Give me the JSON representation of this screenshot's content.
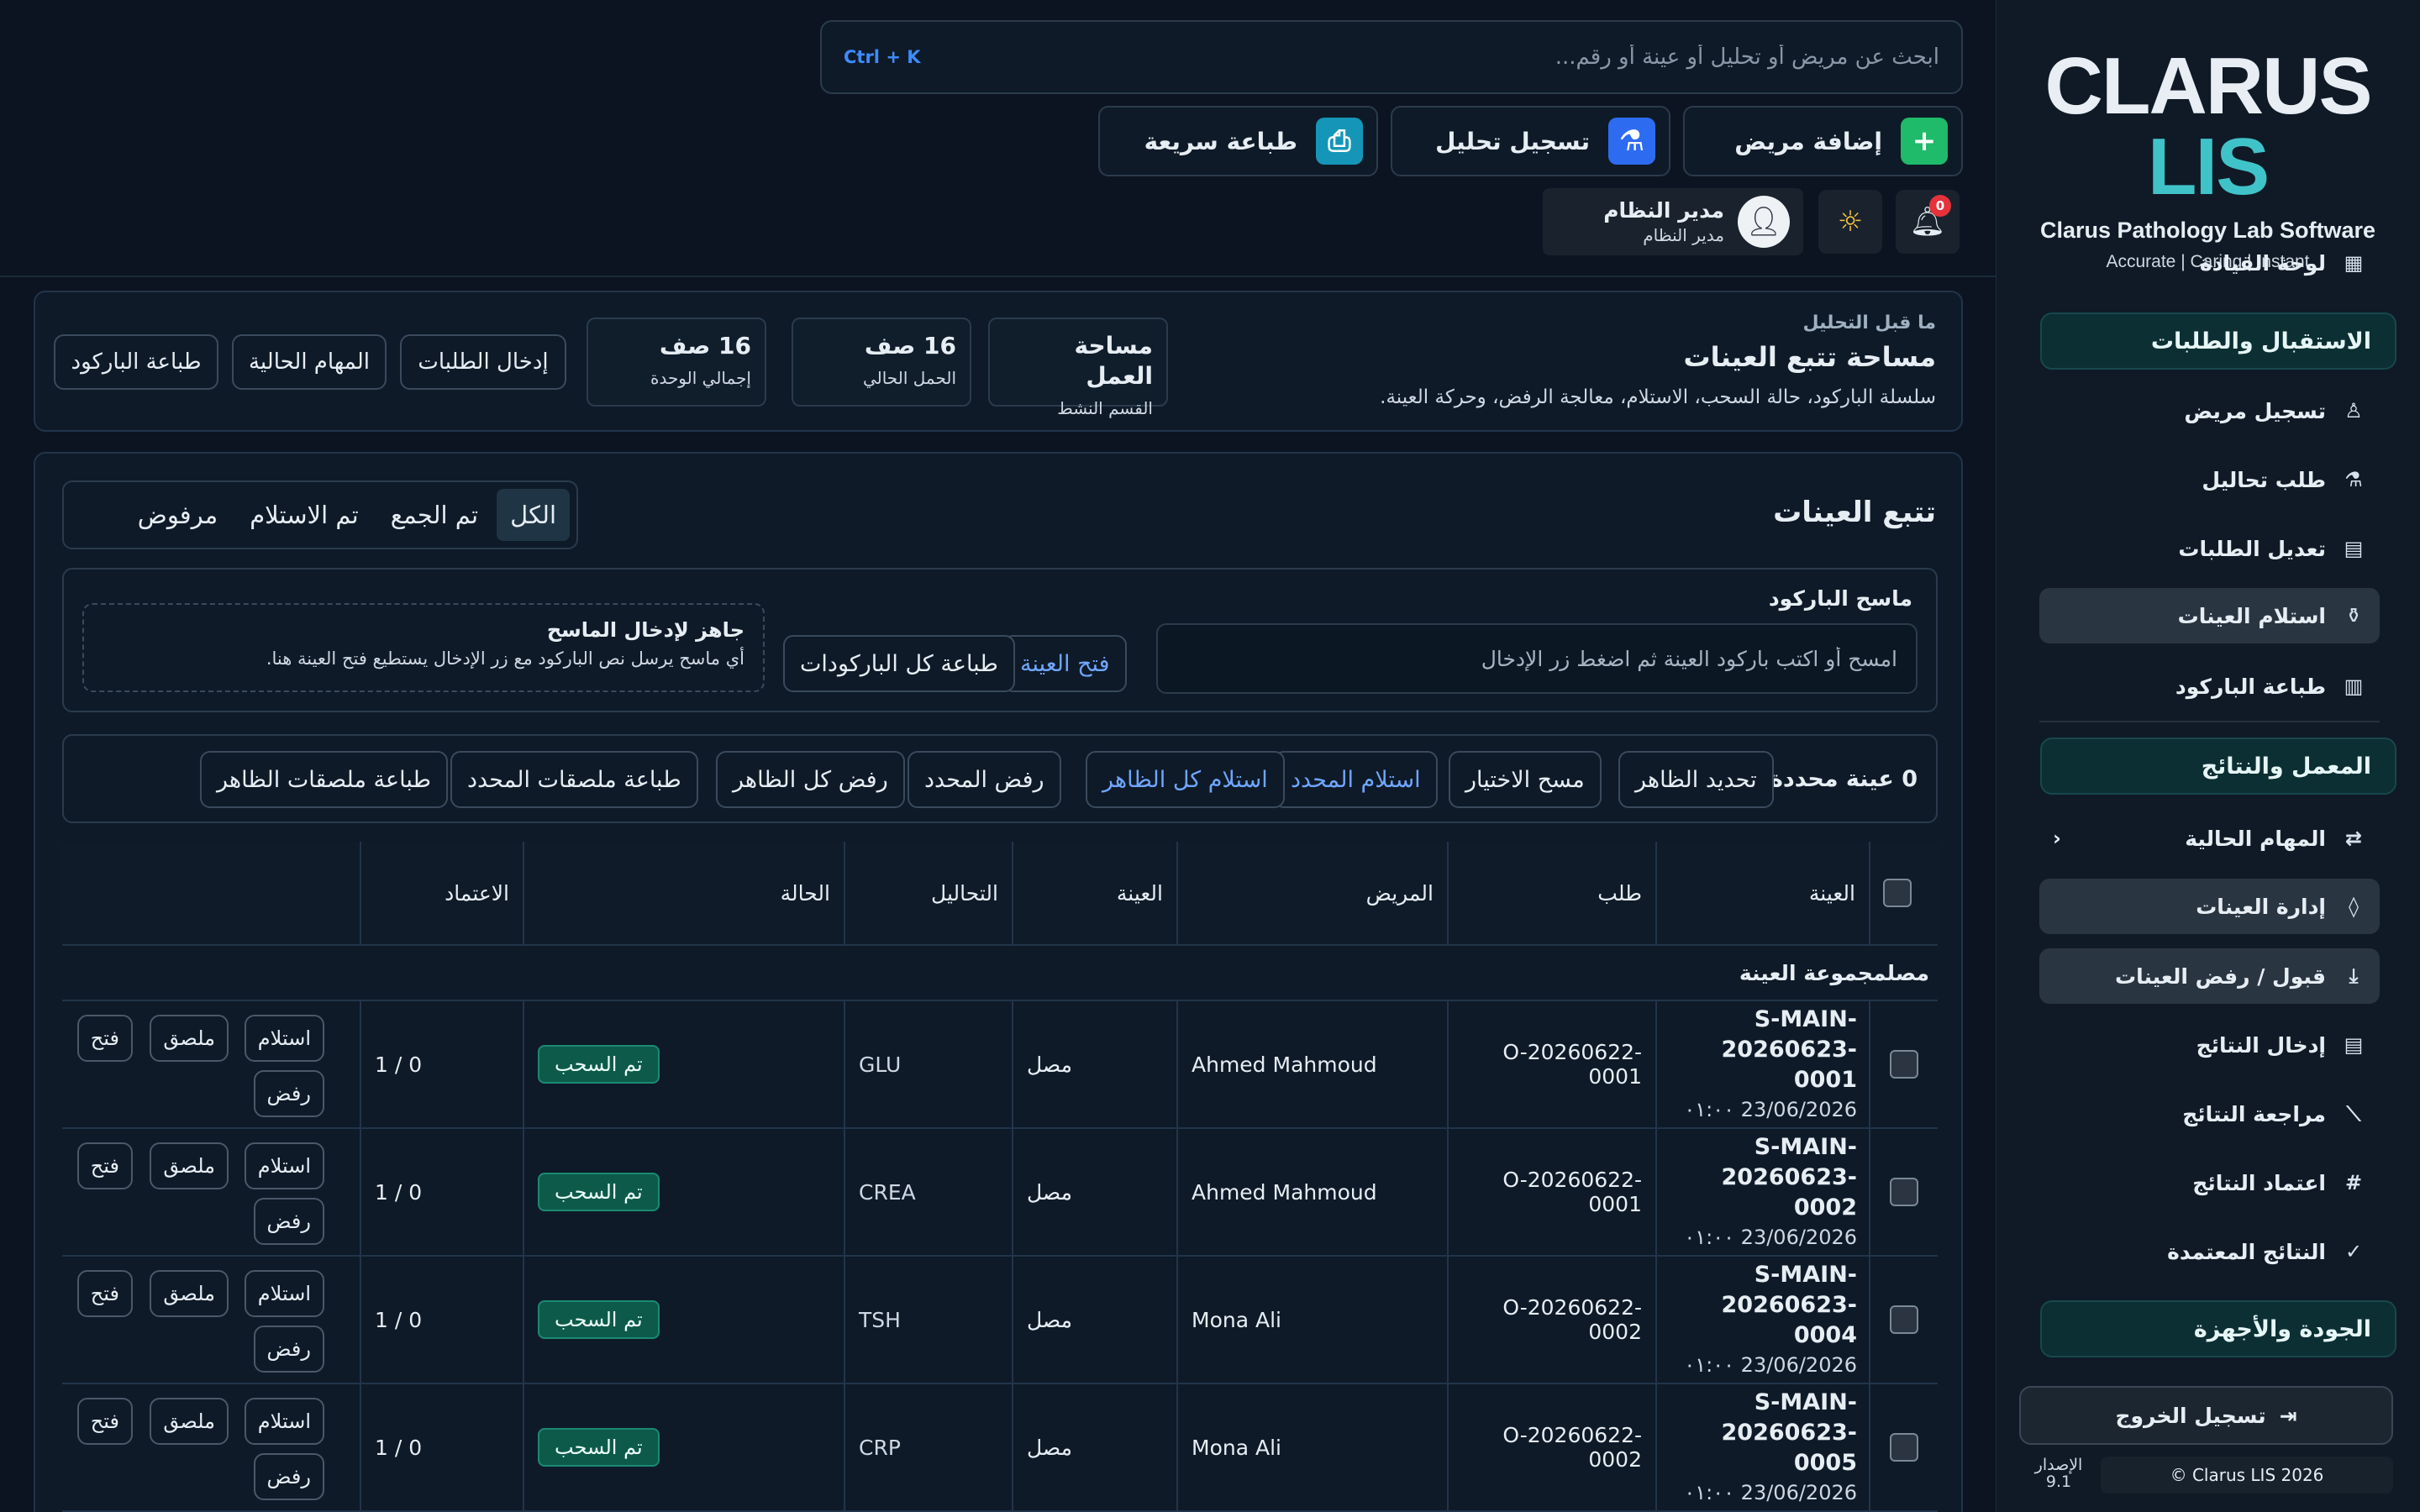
{
  "brand": {
    "logo_main": "CLARUS",
    "logo_accent": "LIS",
    "subtitle": "Clarus Pathology Lab Software",
    "tagline": "Accurate | Caring | Instant"
  },
  "sidebar": {
    "dashboard": "لوحة القيادة",
    "section_reception": "الاستقبال والطلبات",
    "register_patient": "تسجيل مريض",
    "order_tests": "طلب تحاليل",
    "edit_orders": "تعديل الطلبات",
    "receive_samples": "استلام العينات",
    "print_barcode": "طباعة الباركود",
    "section_lab": "المعمل والنتائج",
    "current_tasks": "المهام الحالية",
    "sample_management": "إدارة العينات",
    "accept_reject": "قبول / رفض العينات",
    "enter_results": "إدخال النتائج",
    "review_results": "مراجعة النتائج",
    "approve_results": "اعتماد النتائج",
    "approved_results": "النتائج المعتمدة",
    "section_quality": "الجودة والأجهزة",
    "logout": "تسجيل الخروج",
    "copyright": "Clarus LIS 2026 ©",
    "version_label": "الإصدار",
    "version_value": "9.1"
  },
  "topbar": {
    "search_placeholder": "ابحث عن مريض أو تحليل أو عينة أو رقم...",
    "shortcut": "Ctrl + K",
    "add_patient": "إضافة مريض",
    "register_test": "تسجيل تحليل",
    "quick_print": "طباعة سريعة",
    "user_name": "مدير النظام",
    "user_role": "مدير النظام",
    "notification_count": "0"
  },
  "hero": {
    "kicker": "ما قبل التحليل",
    "title": "مساحة تتبع العينات",
    "subtitle": "سلسلة الباركود، حالة السحب، الاستلام، معالجة الرفض، وحركة العينة.",
    "stats": [
      {
        "value": "مساحة العمل",
        "label": "القسم النشط"
      },
      {
        "value": "16 صف",
        "label": "الحمل الحالي"
      },
      {
        "value": "16 صف",
        "label": "إجمالي الوحدة"
      }
    ],
    "buttons": [
      "إدخال الطلبات",
      "المهام الحالية",
      "طباعة الباركود"
    ]
  },
  "tracking": {
    "title": "تتبع العينات",
    "filters": [
      "الكل",
      "تم الجمع",
      "تم الاستلام",
      "مرفوض"
    ],
    "active_filter": "الكل",
    "scanner_label": "ماسح الباركود",
    "scanner_placeholder": "امسح أو اكتب باركود العينة ثم اضغط زر الإدخال",
    "open_sample": "فتح العينة",
    "print_all_barcodes": "طباعة كل الباركودات",
    "ready_title": "جاهز لإدخال الماسح",
    "ready_desc": "أي ماسح يرسل نص الباركود مع زر الإدخال يستطيع فتح العينة هنا.",
    "selected_count": "0 عينة محددة",
    "bulk_actions": [
      "تحديد الظاهر",
      "مسح الاختيار",
      "استلام المحدد",
      "استلام كل الظاهر",
      "رفض المحدد",
      "رفض كل الظاهر",
      "طباعة ملصقات المحدد",
      "طباعة ملصقات الظاهر"
    ]
  },
  "table": {
    "headers": {
      "sample": "العينة",
      "order": "طلب",
      "patient": "المريض",
      "specimen": "العينة",
      "tests": "التحاليل",
      "status": "الحالة",
      "approval": "الاعتماد"
    },
    "group_label": "مجموعة العينة",
    "group_value": "مصل",
    "action_labels": {
      "open": "فتح",
      "label": "ملصق",
      "receive": "استلام",
      "reject": "رفض"
    },
    "rows": [
      {
        "sample_id": "S-MAIN-20260623-0001",
        "date": "23/06/2026 ٠١:٠٠",
        "order": "O-20260622-0001",
        "patient": "Ahmed Mahmoud",
        "specimen": "مصل",
        "test": "GLU",
        "status": "تم السحب",
        "approval": "1 / 0"
      },
      {
        "sample_id": "S-MAIN-20260623-0002",
        "date": "23/06/2026 ٠١:٠٠",
        "order": "O-20260622-0001",
        "patient": "Ahmed Mahmoud",
        "specimen": "مصل",
        "test": "CREA",
        "status": "تم السحب",
        "approval": "1 / 0"
      },
      {
        "sample_id": "S-MAIN-20260623-0004",
        "date": "23/06/2026 ٠١:٠٠",
        "order": "O-20260622-0002",
        "patient": "Mona Ali",
        "specimen": "مصل",
        "test": "TSH",
        "status": "تم السحب",
        "approval": "1 / 0"
      },
      {
        "sample_id": "S-MAIN-20260623-0005",
        "date": "23/06/2026 ٠١:٠٠",
        "order": "O-20260622-0002",
        "patient": "Mona Ali",
        "specimen": "مصل",
        "test": "CRP",
        "status": "تم السحب",
        "approval": "1 / 0"
      }
    ]
  },
  "colors": {
    "accent_teal": "#3fc3c8",
    "accent_green": "#1fba6a",
    "accent_blue": "#2d6cf0",
    "status_green": "#0d5a4b",
    "link_blue": "#6fa6ff"
  }
}
